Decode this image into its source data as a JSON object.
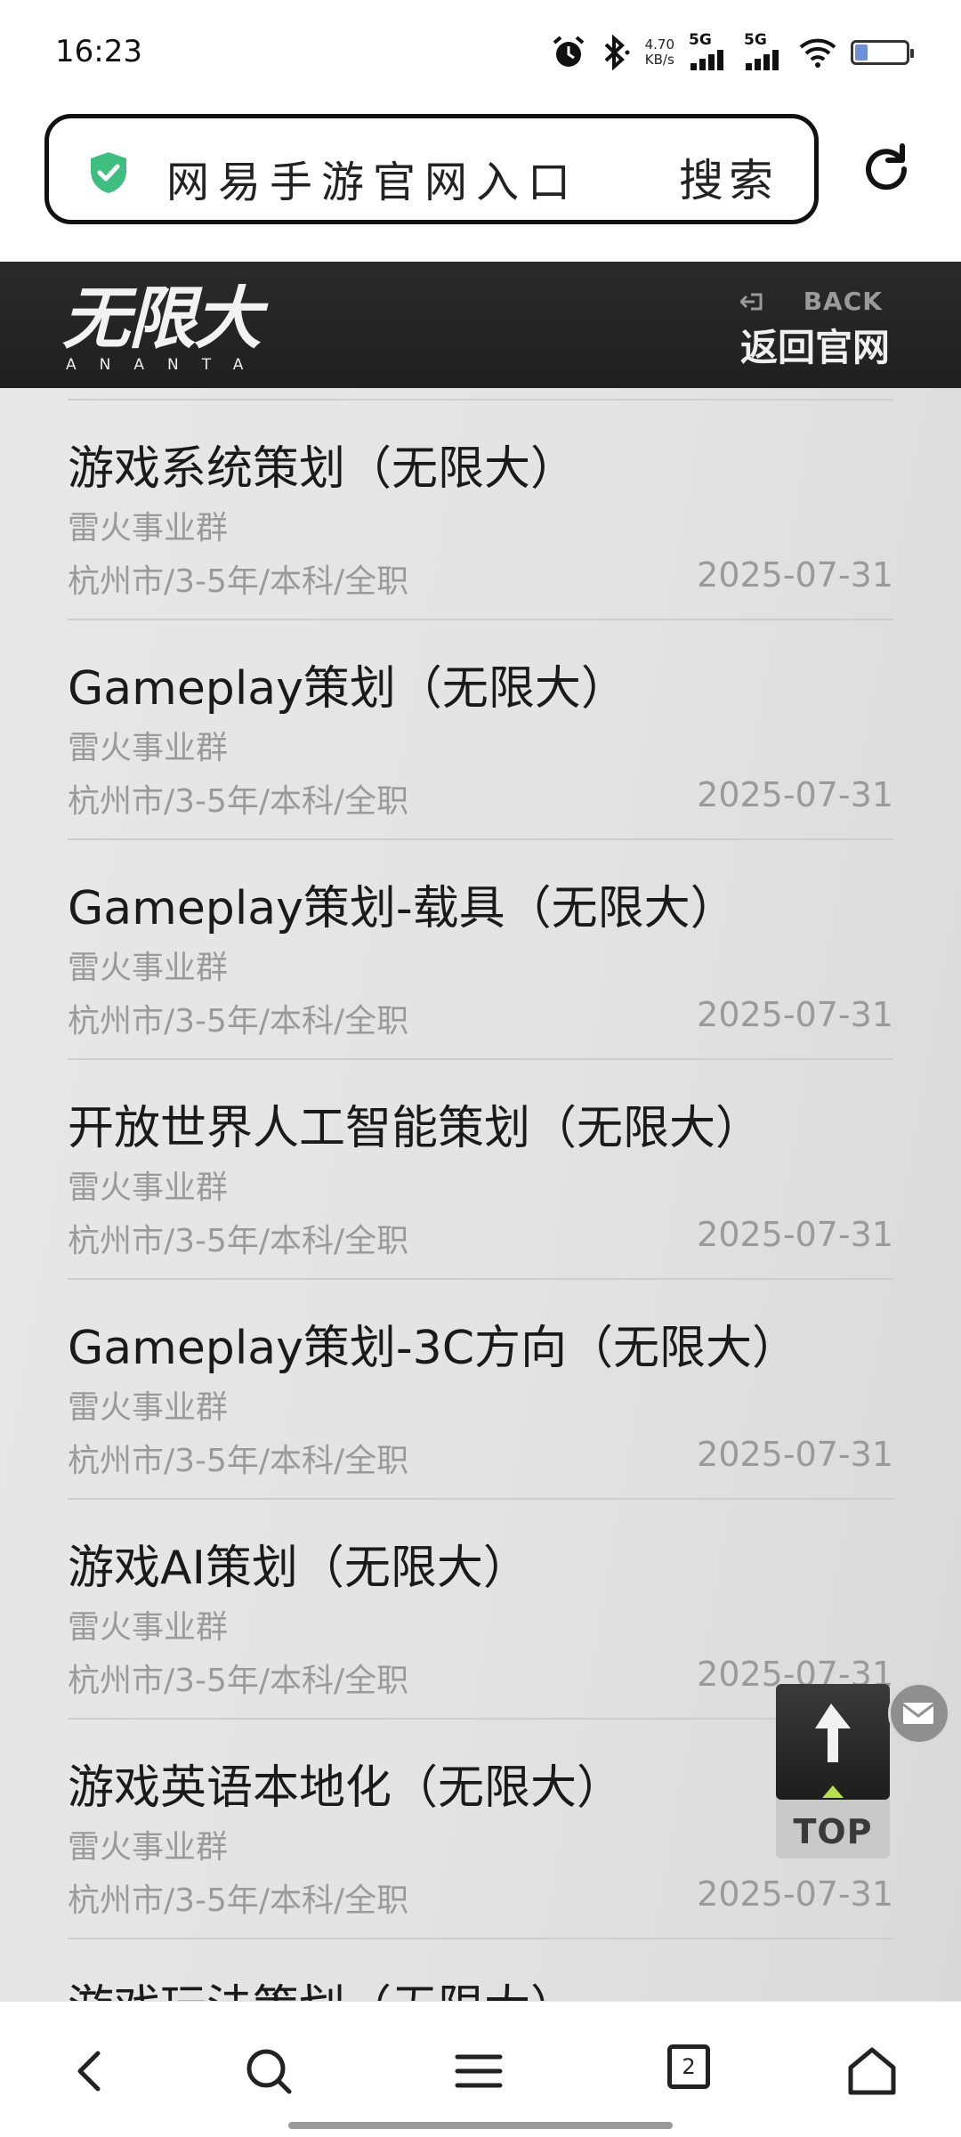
{
  "status_bar": {
    "time": "16:23",
    "net_speed_value": "4.70",
    "net_speed_unit": "KB/s",
    "sim1": "5G",
    "sim2": "5G",
    "battery": "16"
  },
  "search": {
    "query": "网易手游官网入口",
    "button": "搜索"
  },
  "site_header": {
    "logo": "无限大",
    "logo_sub": "ANANTA",
    "back_en": "BACK",
    "back_cn": "返回官网"
  },
  "jobs": [
    {
      "title": "游戏系统策划（无限大）",
      "dept": "雷火事业群",
      "meta": "杭州市/3-5年/本科/全职",
      "date": "2025-07-31"
    },
    {
      "title": "Gameplay策划（无限大）",
      "dept": "雷火事业群",
      "meta": "杭州市/3-5年/本科/全职",
      "date": "2025-07-31"
    },
    {
      "title": "Gameplay策划-载具（无限大）",
      "dept": "雷火事业群",
      "meta": "杭州市/3-5年/本科/全职",
      "date": "2025-07-31"
    },
    {
      "title": "开放世界人工智能策划（无限大）",
      "dept": "雷火事业群",
      "meta": "杭州市/3-5年/本科/全职",
      "date": "2025-07-31"
    },
    {
      "title": "Gameplay策划-3C方向（无限大）",
      "dept": "雷火事业群",
      "meta": "杭州市/3-5年/本科/全职",
      "date": "2025-07-31"
    },
    {
      "title": "游戏AI策划（无限大）",
      "dept": "雷火事业群",
      "meta": "杭州市/3-5年/本科/全职",
      "date": "2025-07-31"
    },
    {
      "title": "游戏英语本地化（无限大）",
      "dept": "雷火事业群",
      "meta": "杭州市/3-5年/本科/全职",
      "date": "2025-07-31"
    },
    {
      "title": "游戏玩法策划（无限大）",
      "dept": "",
      "meta": "",
      "date": ""
    }
  ],
  "top_button": {
    "label": "TOP"
  },
  "bottom_nav": {
    "tab_count": "2"
  },
  "colors": {
    "header_bg": "#222222",
    "shield_green": "#3fbf7f",
    "muted_text": "#9a9a9a",
    "top_arrow_accent": "#b8e04a"
  }
}
